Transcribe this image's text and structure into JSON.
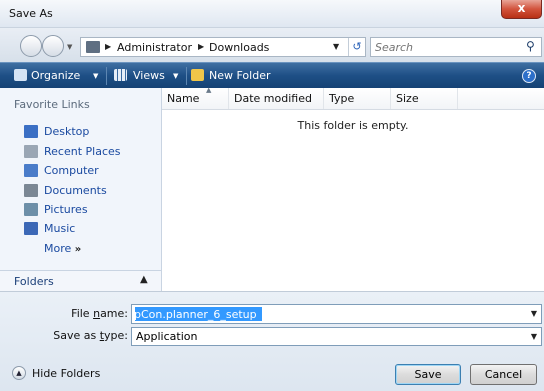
{
  "window": {
    "title": "Save As",
    "close_label": "x"
  },
  "address": {
    "crumbs": [
      "Administrator",
      "Downloads"
    ],
    "search_placeholder": "Search"
  },
  "toolbar": {
    "organize_label": "Organize",
    "views_label": "Views",
    "new_folder_label": "New Folder",
    "help_label": "?"
  },
  "sidebar": {
    "heading": "Favorite Links",
    "items": [
      {
        "label": "Desktop",
        "icon": "desktop-icon"
      },
      {
        "label": "Recent Places",
        "icon": "recent-places-icon"
      },
      {
        "label": "Computer",
        "icon": "computer-icon"
      },
      {
        "label": "Documents",
        "icon": "documents-icon"
      },
      {
        "label": "Pictures",
        "icon": "pictures-icon"
      },
      {
        "label": "Music",
        "icon": "music-icon"
      }
    ],
    "more_label": "More",
    "folders_label": "Folders"
  },
  "filelist": {
    "columns": [
      "Name",
      "Date modified",
      "Type",
      "Size"
    ],
    "empty_message": "This folder is empty."
  },
  "form": {
    "file_name_label_prefix": "File ",
    "file_name_label_key": "n",
    "file_name_label_suffix": "ame:",
    "file_name_value": "pCon.planner_6_setup",
    "save_type_label_prefix": "Save as ",
    "save_type_label_key": "t",
    "save_type_label_suffix": "ype:",
    "save_type_value": "Application"
  },
  "footer": {
    "hide_folders_label": "Hide Folders",
    "save_label": "Save",
    "cancel_label": "Cancel"
  },
  "colors": {
    "toolbar_blue": "#1e4f86",
    "link_blue": "#1b4aa0",
    "selection_blue": "#3399ff",
    "close_red": "#c83c22"
  }
}
